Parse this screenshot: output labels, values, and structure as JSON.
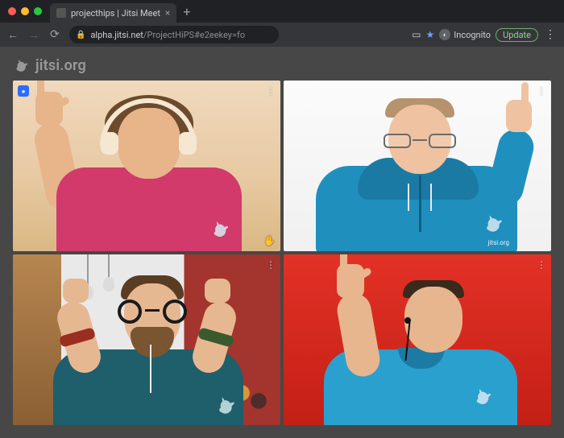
{
  "browser": {
    "tab_title": "projecthips | Jitsi Meet",
    "url_host": "alpha.jitsi.net",
    "url_path": "/ProjectHiPS#e2eekey=fo",
    "incognito_label": "Incognito",
    "update_label": "Update"
  },
  "colors": {
    "traffic_red": "#ff5f57",
    "traffic_yellow": "#febc2e",
    "traffic_green": "#28c840",
    "active_tile_outline": "#3b82f6"
  },
  "page": {
    "brand_text": "jitsi.org"
  },
  "tiles": [
    {
      "id": "participant-1",
      "active": true,
      "dominant_badge": true
    },
    {
      "id": "participant-2",
      "active": false,
      "dominant_badge": false
    },
    {
      "id": "participant-3",
      "active": false,
      "dominant_badge": false
    },
    {
      "id": "participant-4",
      "active": false,
      "dominant_badge": false
    }
  ]
}
